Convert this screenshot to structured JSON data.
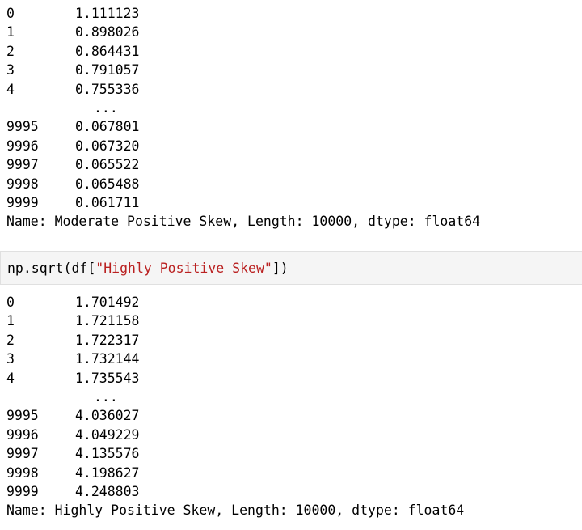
{
  "output1": {
    "rows": [
      {
        "index": "0",
        "value": "1.111123"
      },
      {
        "index": "1",
        "value": "0.898026"
      },
      {
        "index": "2",
        "value": "0.864431"
      },
      {
        "index": "3",
        "value": "0.791057"
      },
      {
        "index": "4",
        "value": "0.755336"
      }
    ],
    "ellipsis": "...",
    "rows_tail": [
      {
        "index": "9995",
        "value": "0.067801"
      },
      {
        "index": "9996",
        "value": "0.067320"
      },
      {
        "index": "9997",
        "value": "0.065522"
      },
      {
        "index": "9998",
        "value": "0.065488"
      },
      {
        "index": "9999",
        "value": "0.061711"
      }
    ],
    "footer": "Name: Moderate Positive Skew, Length: 10000, dtype: float64"
  },
  "input_cell": {
    "code_prefix": "np.sqrt(df[",
    "code_string": "\"Highly Positive Skew\"",
    "code_suffix": "])"
  },
  "output2": {
    "rows": [
      {
        "index": "0",
        "value": "1.701492"
      },
      {
        "index": "1",
        "value": "1.721158"
      },
      {
        "index": "2",
        "value": "1.722317"
      },
      {
        "index": "3",
        "value": "1.732144"
      },
      {
        "index": "4",
        "value": "1.735543"
      }
    ],
    "ellipsis": "...",
    "rows_tail": [
      {
        "index": "9995",
        "value": "4.036027"
      },
      {
        "index": "9996",
        "value": "4.049229"
      },
      {
        "index": "9997",
        "value": "4.135576"
      },
      {
        "index": "9998",
        "value": "4.198627"
      },
      {
        "index": "9999",
        "value": "4.248803"
      }
    ],
    "footer": "Name: Highly Positive Skew, Length: 10000, dtype: float64"
  }
}
